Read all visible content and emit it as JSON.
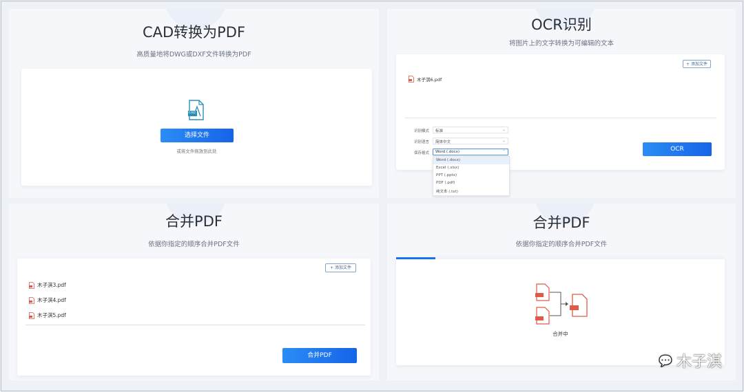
{
  "cad": {
    "title": "CAD转换为PDF",
    "subtitle": "高质量地将DWG或DXF文件转换为PDF",
    "select_button": "选择文件",
    "drop_hint": "或将文件拖放到此处",
    "icon_text": "CAD"
  },
  "ocr": {
    "title": "OCR识别",
    "subtitle": "将图片上的文字转换为可编辑的文本",
    "add_button": "+ 添加文件",
    "file_name": "木子淇6.pdf",
    "mode_label": "识别模式",
    "mode_value": "标准",
    "lang_label": "识别语言",
    "lang_value": "简体中文",
    "format_label": "保存格式",
    "format_value": "Word (.docx)",
    "format_options": [
      "Word (.docx)",
      "Excel (.xlsx)",
      "PPT (.pptx)",
      "PDF (.pdf)",
      "纯文本 (.txt)"
    ],
    "ocr_button": "OCR"
  },
  "merge": {
    "title": "合并PDF",
    "subtitle": "依据你指定的顺序合并PDF文件",
    "add_button": "+ 添加文件",
    "files": [
      "木子淇3.pdf",
      "木子淇4.pdf",
      "木子淇5.pdf"
    ],
    "merge_button": "合并PDF"
  },
  "merging": {
    "title": "合并PDF",
    "subtitle": "依据你指定的顺序合并PDF文件",
    "status": "合并中",
    "progress": 0.12
  },
  "watermark": "木子淇",
  "colors": {
    "accent": "#1a73e8",
    "pdf_red": "#e05a4a"
  }
}
